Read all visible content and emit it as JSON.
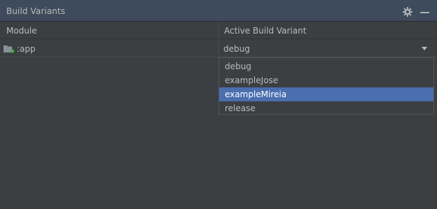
{
  "panel": {
    "title": "Build Variants"
  },
  "toolbar": {
    "settings_icon": "gear-icon",
    "minimize_icon": "minimize-icon"
  },
  "table": {
    "columns": [
      "Module",
      "Active Build Variant"
    ],
    "rows": [
      {
        "module": ":app",
        "module_icon": "module-folder-icon",
        "active_variant": "debug"
      }
    ]
  },
  "dropdown": {
    "expanded": true,
    "options": [
      "debug",
      "exampleJose",
      "exampleMireia",
      "release"
    ],
    "highlighted": "exampleMireia"
  },
  "colors": {
    "titlebar_bg": "#3d4b5c",
    "panel_bg": "#3c3f41",
    "highlight_bg": "#4b6eaf",
    "text": "#bbbbbb",
    "module_badge": "#4caf50"
  }
}
